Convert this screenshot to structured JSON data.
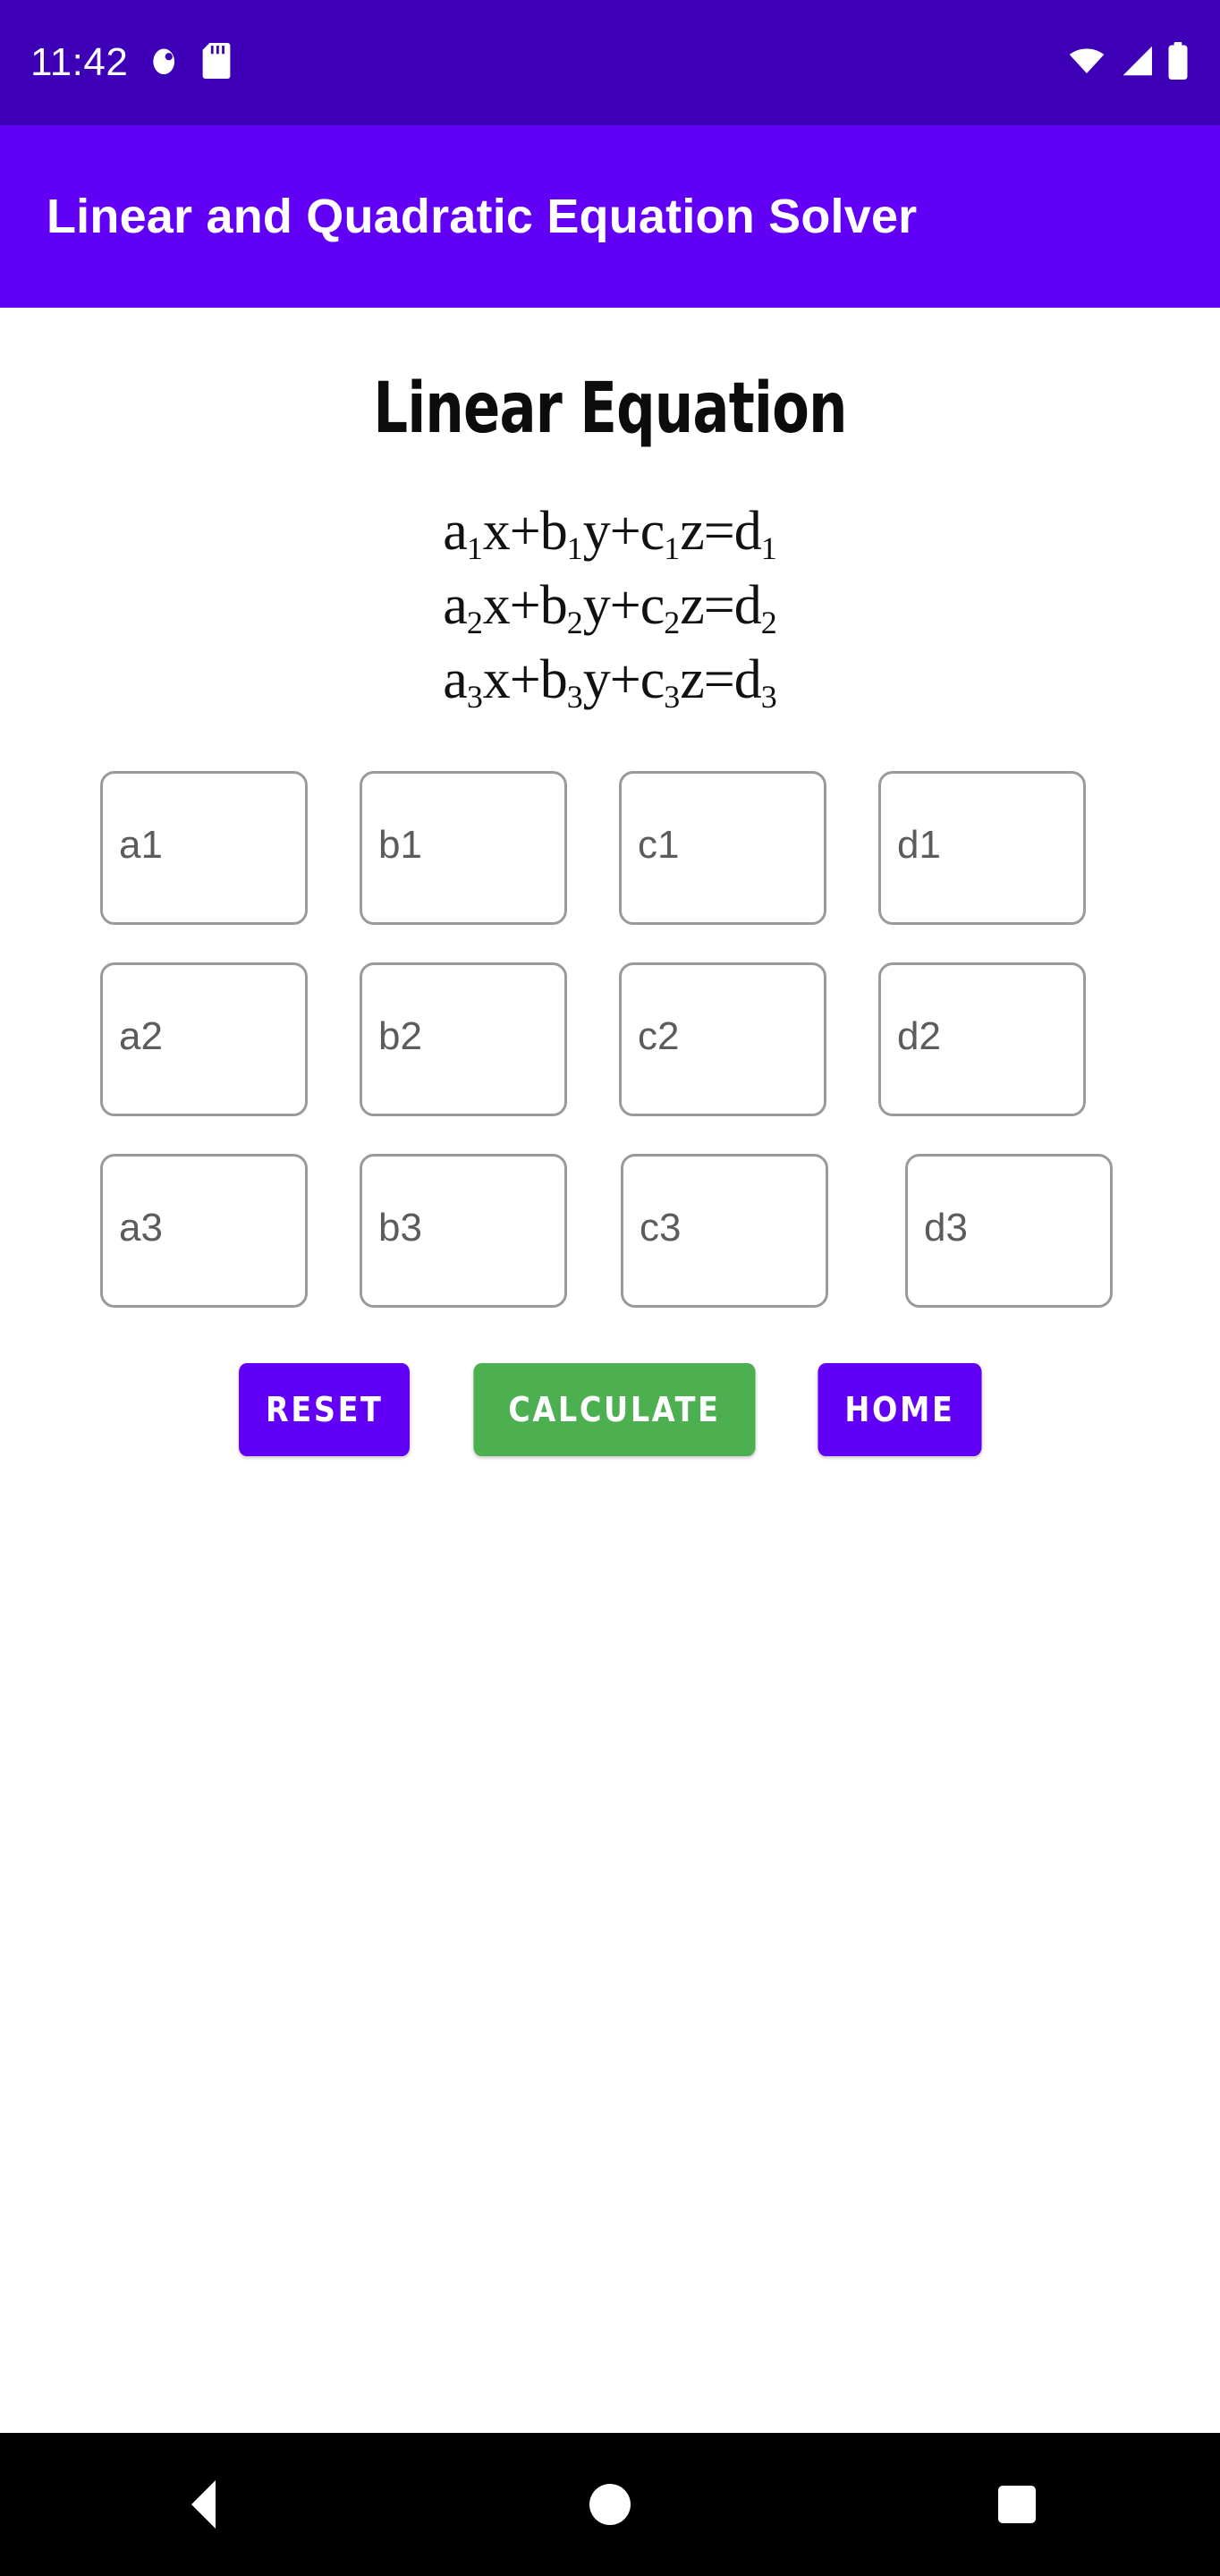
{
  "status_bar": {
    "time": "11:42",
    "left_icons": [
      "alarm-clock-icon",
      "sd-card-icon"
    ],
    "right_icons": [
      "wifi-icon",
      "cellular-signal-icon",
      "battery-icon"
    ],
    "background_color": "#3d00b7"
  },
  "app_bar": {
    "title": "Linear and Quadratic Equation Solver",
    "background_color": "#6200f5",
    "text_color": "#ffffff"
  },
  "main": {
    "section_title": "Linear Equation",
    "equations": [
      {
        "a": "a",
        "a_sub": "1",
        "b": "b",
        "b_sub": "1",
        "c": "c",
        "c_sub": "1",
        "d": "d",
        "d_sub": "1"
      },
      {
        "a": "a",
        "a_sub": "2",
        "b": "b",
        "b_sub": "2",
        "c": "c",
        "c_sub": "2",
        "d": "d",
        "d_sub": "2"
      },
      {
        "a": "a",
        "a_sub": "3",
        "b": "b",
        "b_sub": "3",
        "c": "c",
        "c_sub": "3",
        "d": "d",
        "d_sub": "3"
      }
    ],
    "equation_parts": {
      "x": "x",
      "y": "y",
      "z": "z",
      "plus": "+",
      "equals": "="
    },
    "fields": {
      "row1": [
        {
          "name": "a1",
          "placeholder": "a1",
          "value": ""
        },
        {
          "name": "b1",
          "placeholder": "b1",
          "value": ""
        },
        {
          "name": "c1",
          "placeholder": "c1",
          "value": ""
        },
        {
          "name": "d1",
          "placeholder": "d1",
          "value": ""
        }
      ],
      "row2": [
        {
          "name": "a2",
          "placeholder": "a2",
          "value": ""
        },
        {
          "name": "b2",
          "placeholder": "b2",
          "value": ""
        },
        {
          "name": "c2",
          "placeholder": "c2",
          "value": ""
        },
        {
          "name": "d2",
          "placeholder": "d2",
          "value": ""
        }
      ],
      "row3": [
        {
          "name": "a3",
          "placeholder": "a3",
          "value": ""
        },
        {
          "name": "b3",
          "placeholder": "b3",
          "value": ""
        },
        {
          "name": "c3",
          "placeholder": "c3",
          "value": ""
        },
        {
          "name": "d3",
          "placeholder": "d3",
          "value": ""
        }
      ]
    },
    "buttons": [
      {
        "label": "RESET",
        "color": "#6200f5"
      },
      {
        "label": "CALCULATE",
        "color": "#4caf50"
      },
      {
        "label": "HOME",
        "color": "#6200f5"
      }
    ]
  },
  "nav_bar": {
    "background_color": "#000000",
    "items": [
      "back-icon",
      "home-icon",
      "recent-apps-icon"
    ]
  }
}
